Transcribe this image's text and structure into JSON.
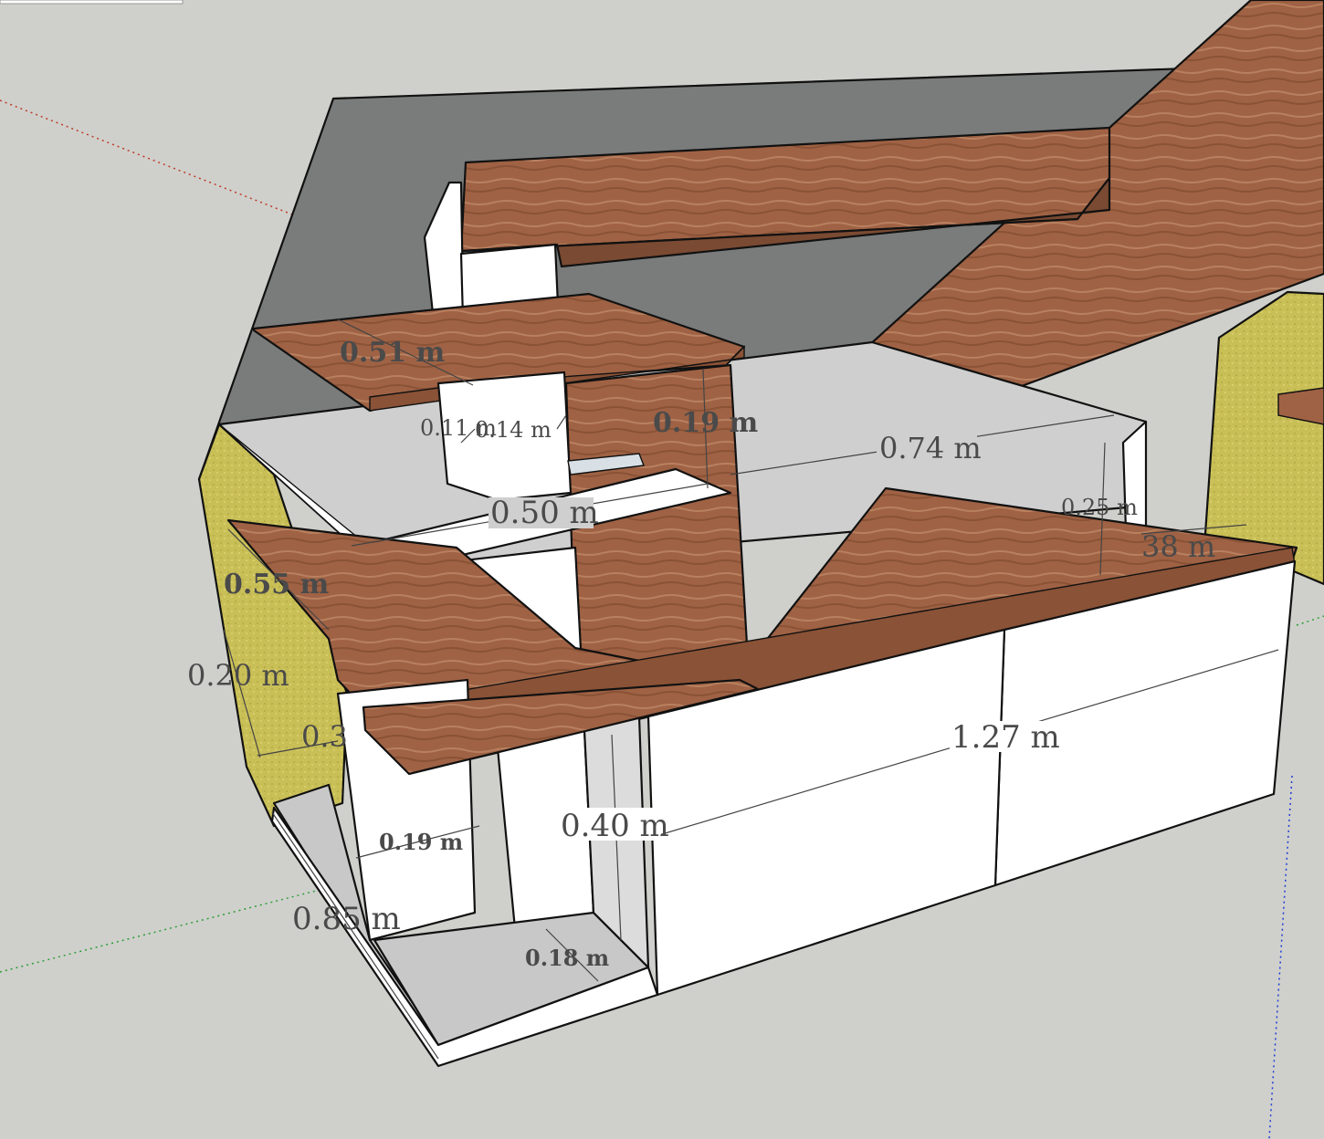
{
  "app": {
    "name": "SketchUp model viewport"
  },
  "colors": {
    "background": "#cfd0cb",
    "roof_underside": "#7a7b7b",
    "wood": "#9a5f40",
    "wood_light": "#b77a57",
    "insulation": "#c5bb55",
    "white_panel": "#ffffff",
    "grey_panel": "#c8c8c8"
  },
  "axes": {
    "red": "#c0392b",
    "green": "#2e9d3b",
    "blue": "#1f3bd6"
  },
  "dimensions": {
    "d051": "0.51 m",
    "d011": "0.11 m",
    "d014": "0.14 m",
    "d019_top": "0.19 m",
    "d074": "0.74 m",
    "d050": "0.50 m",
    "d025": "0.25 m",
    "d038": "38 m",
    "d055": "0.55 m",
    "d020": "0.20 m",
    "d03": "0.3",
    "d127": "1.27 m",
    "d040": "0.40 m",
    "d019_low": "0.19 m",
    "d085": "0.85 m",
    "d018": "0.18 m"
  }
}
